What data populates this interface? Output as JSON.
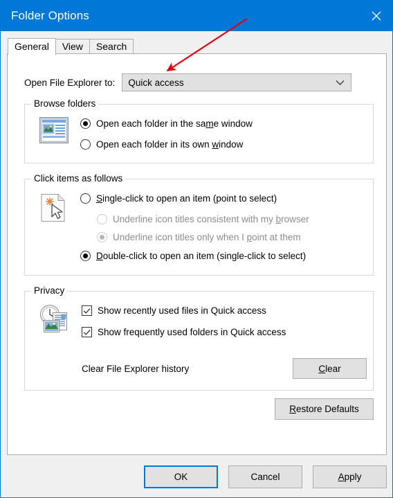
{
  "window": {
    "title": "Folder Options",
    "close_icon": "close-icon",
    "accent_color": "#0078d7",
    "titlebar_bg": "#0078d7",
    "dialog_bg": "#f0f0f0",
    "page_bg": "#ffffff"
  },
  "tabs": [
    {
      "label": "General",
      "selected": true
    },
    {
      "label": "View",
      "selected": false
    },
    {
      "label": "Search",
      "selected": false
    }
  ],
  "general": {
    "open_to": {
      "label": "Open File Explorer to:",
      "value": "Quick access",
      "arrow_icon": "chevron-down-icon"
    },
    "browse_folders": {
      "title": "Browse folders",
      "icon": "explorer-window-icon",
      "options": [
        {
          "label_before": "Open each folder in the sa",
          "accel": "m",
          "label_after": "e window",
          "checked": true,
          "disabled": false
        },
        {
          "label_before": "Open each folder in its own ",
          "accel": "w",
          "label_after": "indow",
          "checked": false,
          "disabled": false
        }
      ]
    },
    "click_items": {
      "title": "Click items as follows",
      "icon": "pointer-document-icon",
      "options": [
        {
          "label_before": "",
          "accel": "S",
          "label_after": "ingle-click to open an item (point to select)",
          "checked": false,
          "disabled": false,
          "indent": false
        },
        {
          "label_before": "Underline icon titles consistent with my ",
          "accel": "b",
          "label_after": "rowser",
          "checked": false,
          "disabled": true,
          "indent": true
        },
        {
          "label_before": "Underline icon titles only when I ",
          "accel": "p",
          "label_after": "oint at them",
          "checked": true,
          "disabled": true,
          "indent": true
        },
        {
          "label_before": "",
          "accel": "D",
          "label_after": "ouble-click to open an item (single-click to select)",
          "checked": true,
          "disabled": false,
          "indent": false
        }
      ]
    },
    "privacy": {
      "title": "Privacy",
      "icon": "clock-documents-icon",
      "checkboxes": [
        {
          "label": "Show recently used files in Quick access",
          "checked": true
        },
        {
          "label": "Show frequently used folders in Quick access",
          "checked": true
        }
      ],
      "clear_history_label": "Clear File Explorer history",
      "clear_button": {
        "label_before": "",
        "accel": "C",
        "label_after": "lear"
      }
    },
    "restore_defaults": {
      "label_before": "",
      "accel": "R",
      "label_after": "estore Defaults"
    }
  },
  "footer": {
    "ok": "OK",
    "cancel": "Cancel",
    "apply": {
      "label_before": "",
      "accel": "A",
      "label_after": "pply"
    }
  },
  "annotation": {
    "arrow_color": "#e8000d",
    "name": "red-arrow-pointing-to-open-file-explorer-dropdown"
  }
}
